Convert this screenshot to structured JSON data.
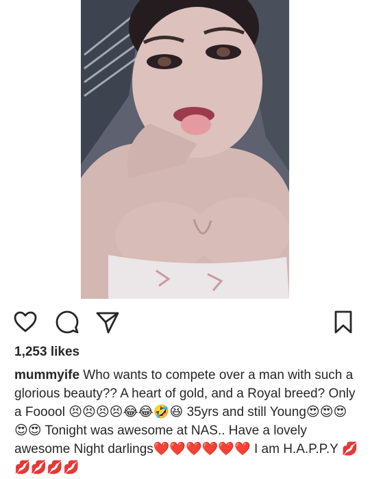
{
  "post": {
    "likes_text": "1,253 likes",
    "username": "mummyife",
    "caption": " Who wants to compete over a man with such a glorious beauty?? A heart of gold, and a Royal breed? Only a Fooool 😣😣😣😣😂😂🤣😆 35yrs and still Young😍😍😍😍😍 Tonight was awesome at NAS.. Have a lovely awesome Night darlings❤️❤️❤️❤️❤️❤️ I am H.A.P.P.Y 💋💋💋💋💋"
  },
  "actions": {
    "like_icon": "heart-outline-icon",
    "comment_icon": "speech-bubble-icon",
    "share_icon": "paper-plane-icon",
    "save_icon": "bookmark-icon"
  },
  "photo": {
    "alt": "selfie of woman sticking out tongue"
  }
}
